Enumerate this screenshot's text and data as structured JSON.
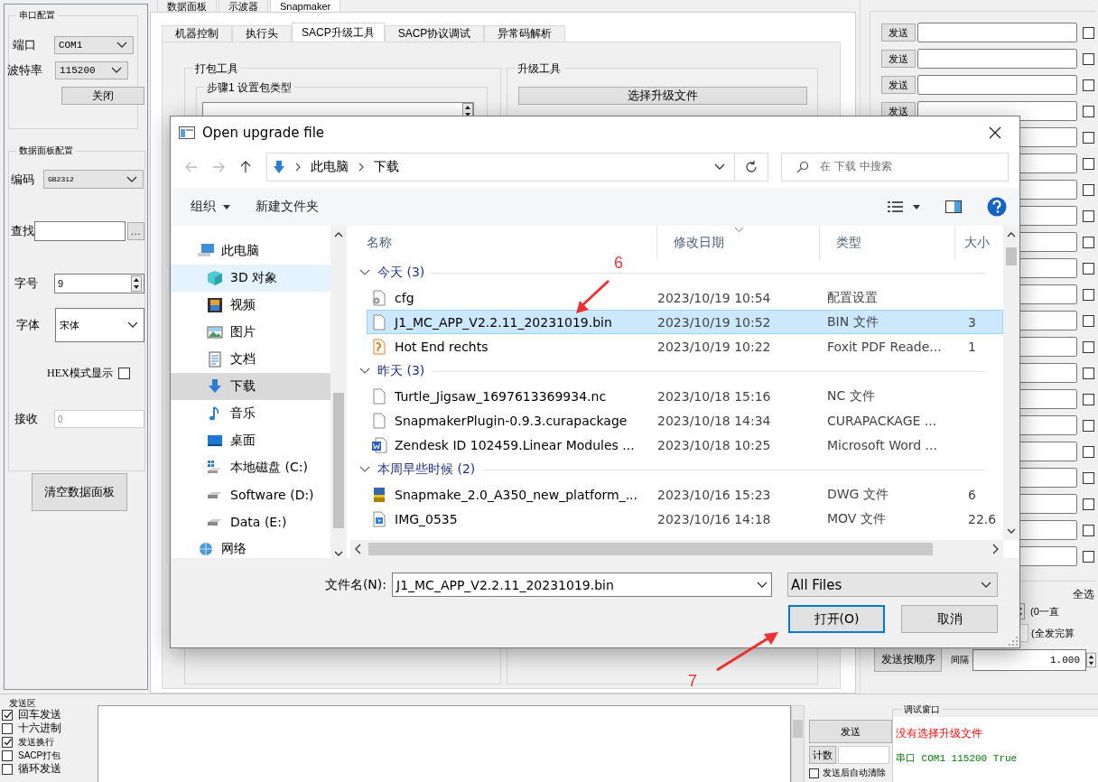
{
  "main_tabs": [
    {
      "label": "数据面板",
      "selected": false
    },
    {
      "label": "示波器",
      "selected": false
    },
    {
      "label": "Snapmaker",
      "selected": true
    }
  ],
  "serial_config": {
    "title": "串口配置",
    "port_label": "端口",
    "port": "COM1",
    "baud_label": "波特率",
    "baud": "115200",
    "close_button": "关闭"
  },
  "panel_config": {
    "title": "数据面板配置",
    "encoding_label": "编码",
    "encoding": "GB2312",
    "find_label": "查找",
    "browse_button": "...",
    "font_size_label": "字号",
    "font_size": "9",
    "font_label": "字体",
    "font": "宋体",
    "hex_label": "HEX模式显示",
    "hex_checked": false,
    "receive_label": "接收",
    "receive_value": "0",
    "clear_button": "清空数据面板"
  },
  "sub_tabs": [
    {
      "label": "机器控制",
      "selected": false
    },
    {
      "label": "执行头",
      "selected": false
    },
    {
      "label": "SACP升级工具",
      "selected": true
    },
    {
      "label": "SACP协议调试",
      "selected": false
    },
    {
      "label": "异常码解析",
      "selected": false
    }
  ],
  "pack_tool": {
    "title": "打包工具",
    "step_title": "步骤1  设置包类型"
  },
  "upgrade_tool": {
    "title": "升级工具",
    "select_button": "选择升级文件"
  },
  "send_rows": [
    {
      "button": "发送",
      "checked": false
    },
    {
      "button": "发送",
      "checked": false
    },
    {
      "button": "发送",
      "checked": false
    },
    {
      "button": "发送",
      "checked": false
    },
    {
      "checked": false
    },
    {
      "checked": false
    },
    {
      "checked": false
    },
    {
      "checked": false
    },
    {
      "checked": false
    },
    {
      "checked": false
    },
    {
      "checked": false
    },
    {
      "checked": false
    },
    {
      "checked": false
    },
    {
      "checked": false
    },
    {
      "checked": false
    },
    {
      "checked": false
    },
    {
      "checked": false
    },
    {
      "checked": false
    },
    {
      "checked": false
    },
    {
      "checked": false
    },
    {
      "checked": false
    }
  ],
  "send_order": {
    "select_all": "全选",
    "loop_hint": "(0一直",
    "count_hint": "(全发完算",
    "order_button": "发送按顺序",
    "interval_label": "间隔",
    "interval": "1.000"
  },
  "send_area": {
    "title": "发送区",
    "options": [
      {
        "label": "回车发送",
        "checked": true,
        "small": false
      },
      {
        "label": "十六进制",
        "checked": false,
        "small": false
      },
      {
        "label": "发送换行",
        "checked": true,
        "small": true
      },
      {
        "label": "SACP打包",
        "checked": false,
        "small": true
      },
      {
        "label": "循环发送",
        "checked": false,
        "small": false
      }
    ],
    "send_button": "发送",
    "count_button": "计数",
    "auto_clear_label": "发送后自动清除",
    "auto_clear_checked": false
  },
  "debug_window": {
    "title": "调试窗口",
    "lines": [
      {
        "text": "没有选择升级文件",
        "kind": "error"
      },
      {
        "text": "串口 COM1 115200 True",
        "kind": "status"
      }
    ]
  },
  "dialog": {
    "title": "Open upgrade file",
    "path": [
      "此电脑",
      "下载"
    ],
    "search_placeholder": "在 下载 中搜索",
    "organize": "组织",
    "new_folder": "新建文件夹",
    "nav_items": [
      {
        "label": "此电脑",
        "kind": "computer",
        "selected": false,
        "hover": false,
        "top": true
      },
      {
        "label": "3D 对象",
        "kind": "cube",
        "selected": false,
        "hover": true,
        "top": false
      },
      {
        "label": "视频",
        "kind": "film",
        "selected": false,
        "hover": false,
        "top": false
      },
      {
        "label": "图片",
        "kind": "image",
        "selected": false,
        "hover": false,
        "top": false
      },
      {
        "label": "文档",
        "kind": "document",
        "selected": false,
        "hover": false,
        "top": false
      },
      {
        "label": "下载",
        "kind": "download",
        "selected": true,
        "hover": false,
        "top": false
      },
      {
        "label": "音乐",
        "kind": "music",
        "selected": false,
        "hover": false,
        "top": false
      },
      {
        "label": "桌面",
        "kind": "desktop",
        "selected": false,
        "hover": false,
        "top": false
      },
      {
        "label": "本地磁盘 (C:)",
        "kind": "system-drive",
        "selected": false,
        "hover": false,
        "top": false
      },
      {
        "label": "Software (D:)",
        "kind": "drive",
        "selected": false,
        "hover": false,
        "top": false
      },
      {
        "label": "Data (E:)",
        "kind": "drive",
        "selected": false,
        "hover": false,
        "top": false
      },
      {
        "label": "网络",
        "kind": "network",
        "selected": false,
        "hover": false,
        "top": true
      }
    ],
    "columns": [
      "名称",
      "修改日期",
      "类型",
      "大小"
    ],
    "groups": [
      {
        "title": "今天 (3)",
        "files": [
          {
            "name": "cfg",
            "date": "2023/10/19 10:54",
            "type": "配置设置",
            "kind": "settings",
            "selected": false
          },
          {
            "name": "J1_MC_APP_V2.2.11_20231019.bin",
            "date": "2023/10/19 10:52",
            "type": "BIN 文件",
            "size": "3",
            "kind": "blank",
            "selected": true
          },
          {
            "name": "Hot End rechts",
            "date": "2023/10/19 10:22",
            "type": "Foxit PDF Reade...",
            "size": "1",
            "kind": "pdf",
            "selected": false
          }
        ]
      },
      {
        "title": "昨天 (3)",
        "files": [
          {
            "name": "Turtle_Jigsaw_1697613369934.nc",
            "date": "2023/10/18 15:16",
            "type": "NC 文件",
            "kind": "blank",
            "selected": false
          },
          {
            "name": "SnapmakerPlugin-0.9.3.curapackage",
            "date": "2023/10/18 14:34",
            "type": "CURAPACKAGE ...",
            "kind": "blank",
            "selected": false
          },
          {
            "name": "Zendesk ID 102459.Linear Modules ...",
            "date": "2023/10/18 10:25",
            "type": "Microsoft Word ...",
            "kind": "word",
            "selected": false
          }
        ]
      },
      {
        "title": "本周早些时候 (2)",
        "files": [
          {
            "name": "Snapmake_2.0_A350_new_platform_...",
            "date": "2023/10/16 15:23",
            "type": "DWG 文件",
            "size": "6",
            "kind": "dwg",
            "selected": false
          },
          {
            "name": "IMG_0535",
            "date": "2023/10/16 14:18",
            "type": "MOV 文件",
            "size": "22.6",
            "kind": "video",
            "selected": false
          }
        ]
      }
    ],
    "filename_label": "文件名(N):",
    "filename": "J1_MC_APP_V2.2.11_20231019.bin",
    "filter": "All Files",
    "open_button": "打开(O)",
    "cancel_button": "取消"
  },
  "annotations": [
    {
      "text": "6"
    },
    {
      "text": "7"
    }
  ]
}
